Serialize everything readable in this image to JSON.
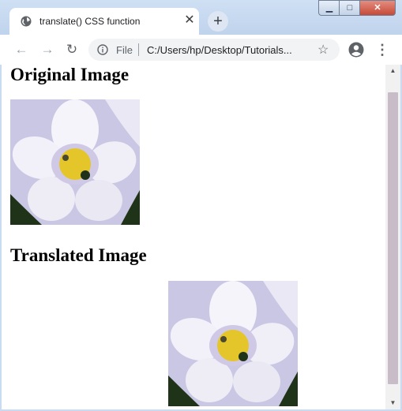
{
  "window": {
    "controls": {
      "minimize": "▁",
      "maximize": "□",
      "close": "✕"
    }
  },
  "tab": {
    "title": "translate() CSS function",
    "close": "✕",
    "icon": "globe-icon"
  },
  "new_tab": "+",
  "toolbar": {
    "back": "←",
    "forward": "→",
    "reload": "↻",
    "scheme_label": "File",
    "url": "C:/Users/hp/Desktop/Tutorials...",
    "bookmark": "☆",
    "menu": "⋮"
  },
  "page": {
    "heading_original": "Original Image",
    "heading_translated": "Translated Image"
  },
  "scrollbar": {
    "up": "▲",
    "down": "▼"
  },
  "colors": {
    "frame": "#c9dbf1",
    "petal": "#f3f1f8",
    "petal_shade": "#cfc9e6",
    "center": "#e4c62a",
    "leaves": "#1f3318"
  }
}
